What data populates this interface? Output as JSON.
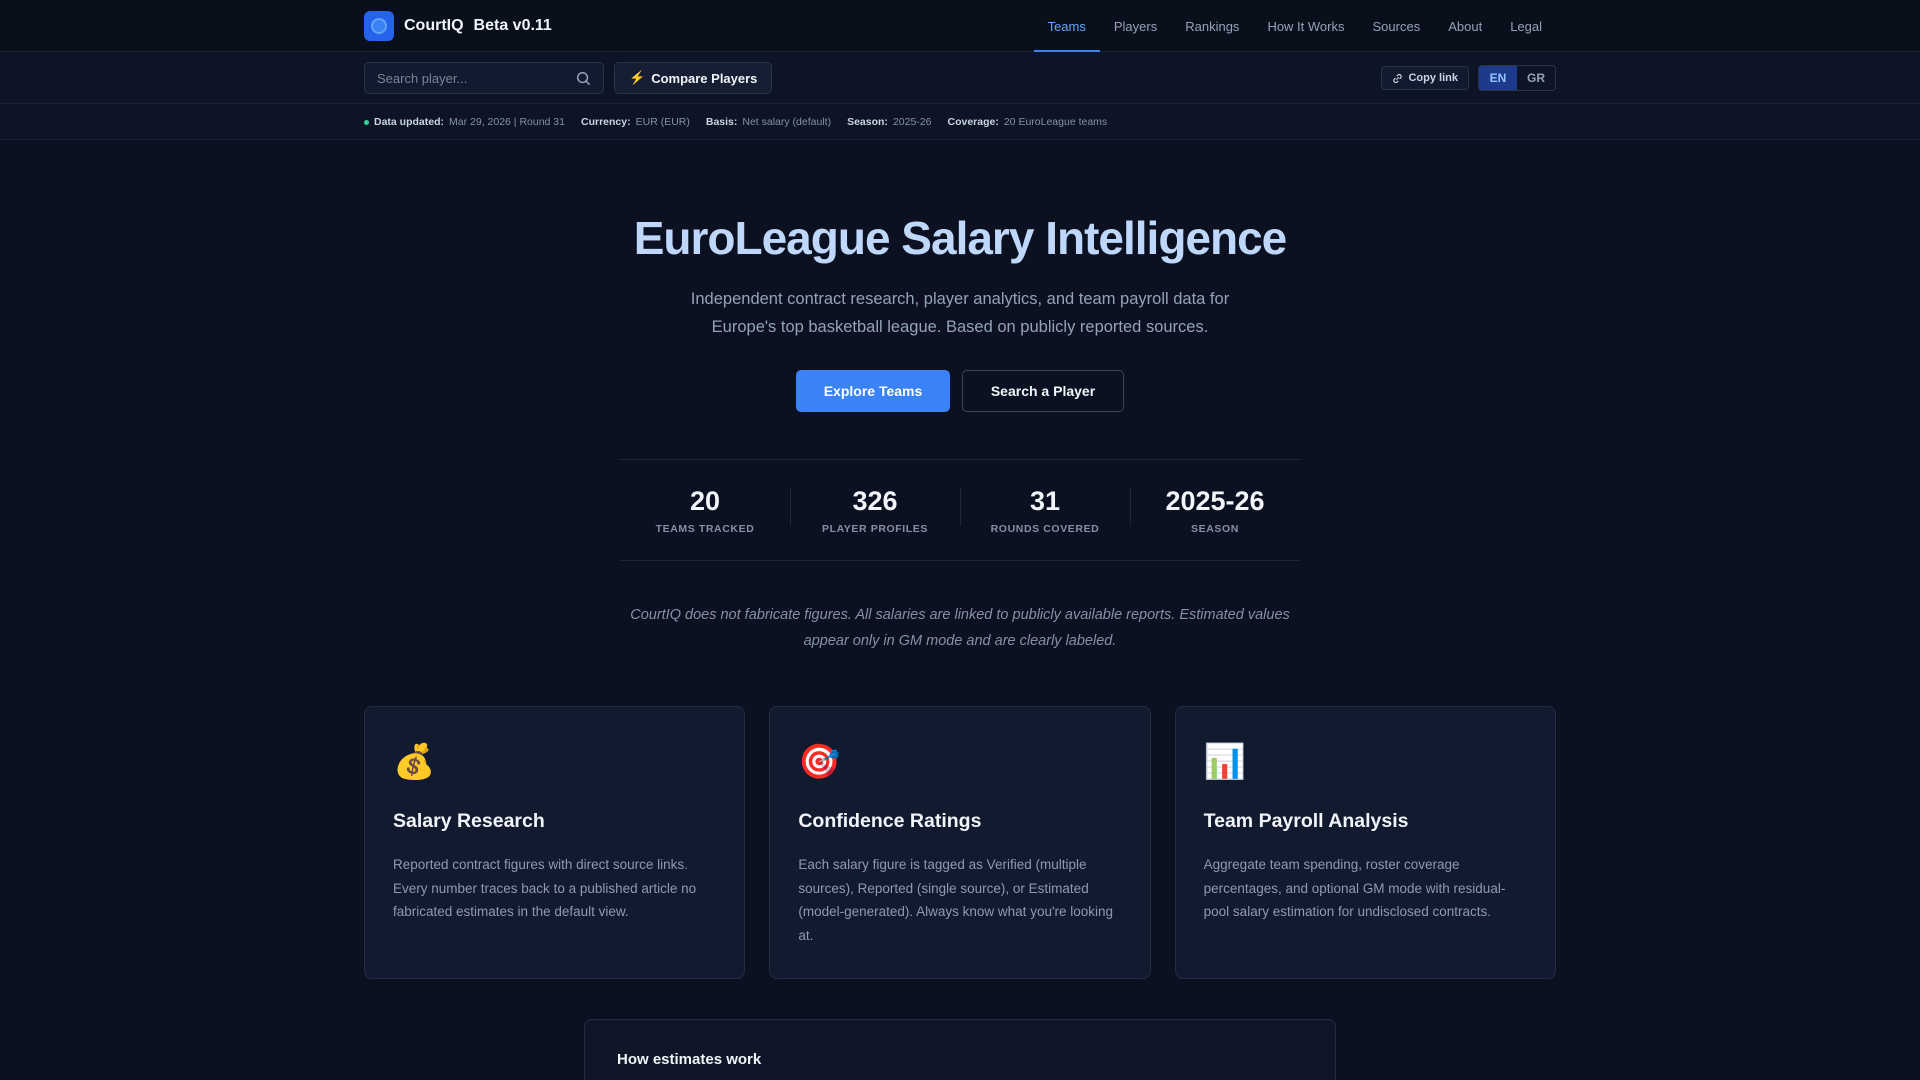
{
  "brand": {
    "name": "CourtIQ",
    "beta": "Beta v0.11",
    "logo_icon": "circle-logo"
  },
  "nav": [
    {
      "label": "Teams",
      "active": true
    },
    {
      "label": "Players"
    },
    {
      "label": "Rankings"
    },
    {
      "label": "How It Works"
    },
    {
      "label": "Sources"
    },
    {
      "label": "About"
    },
    {
      "label": "Legal"
    }
  ],
  "toolbar": {
    "search_placeholder": "Search player...",
    "compare_label": "Compare Players",
    "copy_link_label": "Copy link",
    "lang_en": "EN",
    "lang_gr": "GR",
    "active_lang": "EN"
  },
  "status": {
    "updated_key": "Data updated:",
    "updated_val": "Mar 29, 2026 | Round 31",
    "currency_key": "Currency:",
    "currency_val": "EUR (EUR)",
    "basis_key": "Basis:",
    "basis_val": "Net salary (default)",
    "season_key": "Season:",
    "season_val": "2025-26",
    "coverage_key": "Coverage:",
    "coverage_val": "20 EuroLeague teams",
    "indicator_color": "#34d399"
  },
  "hero": {
    "title": "EuroLeague Salary Intelligence",
    "subtitle": "Independent contract research, player analytics, and team payroll data for Europe's top basketball league. Based on publicly reported sources.",
    "primary_cta": "Explore Teams",
    "secondary_cta": "Search a Player"
  },
  "stats": [
    {
      "value": "20",
      "label": "TEAMS TRACKED"
    },
    {
      "value": "326",
      "label": "PLAYER PROFILES"
    },
    {
      "value": "31",
      "label": "ROUNDS COVERED"
    },
    {
      "value": "2025-26",
      "label": "SEASON"
    }
  ],
  "disclaimer": "CourtIQ does not fabricate figures. All salaries are linked to publicly available reports. Estimated values appear only in GM mode and are clearly labeled.",
  "cards": [
    {
      "icon": "money-bag-icon",
      "glyph": "💰",
      "title": "Salary Research",
      "body": "Reported contract figures with direct source links. Every number traces back to a published article no fabricated estimates in the default view."
    },
    {
      "icon": "target-icon",
      "glyph": "🎯",
      "title": "Confidence Ratings",
      "body": "Each salary figure is tagged as Verified (multiple sources), Reported (single source), or Estimated (model-generated). Always know what you're looking at."
    },
    {
      "icon": "bar-chart-icon",
      "glyph": "📊",
      "title": "Team Payroll Analysis",
      "body": "Aggregate team spending, roster coverage percentages, and optional GM mode with residual-pool salary estimation for undisclosed contracts."
    }
  ],
  "estimates": {
    "title": "How estimates work"
  },
  "colors": {
    "accent": "#3b82f6",
    "background": "#0b1121",
    "title": "#bfd7fb"
  }
}
